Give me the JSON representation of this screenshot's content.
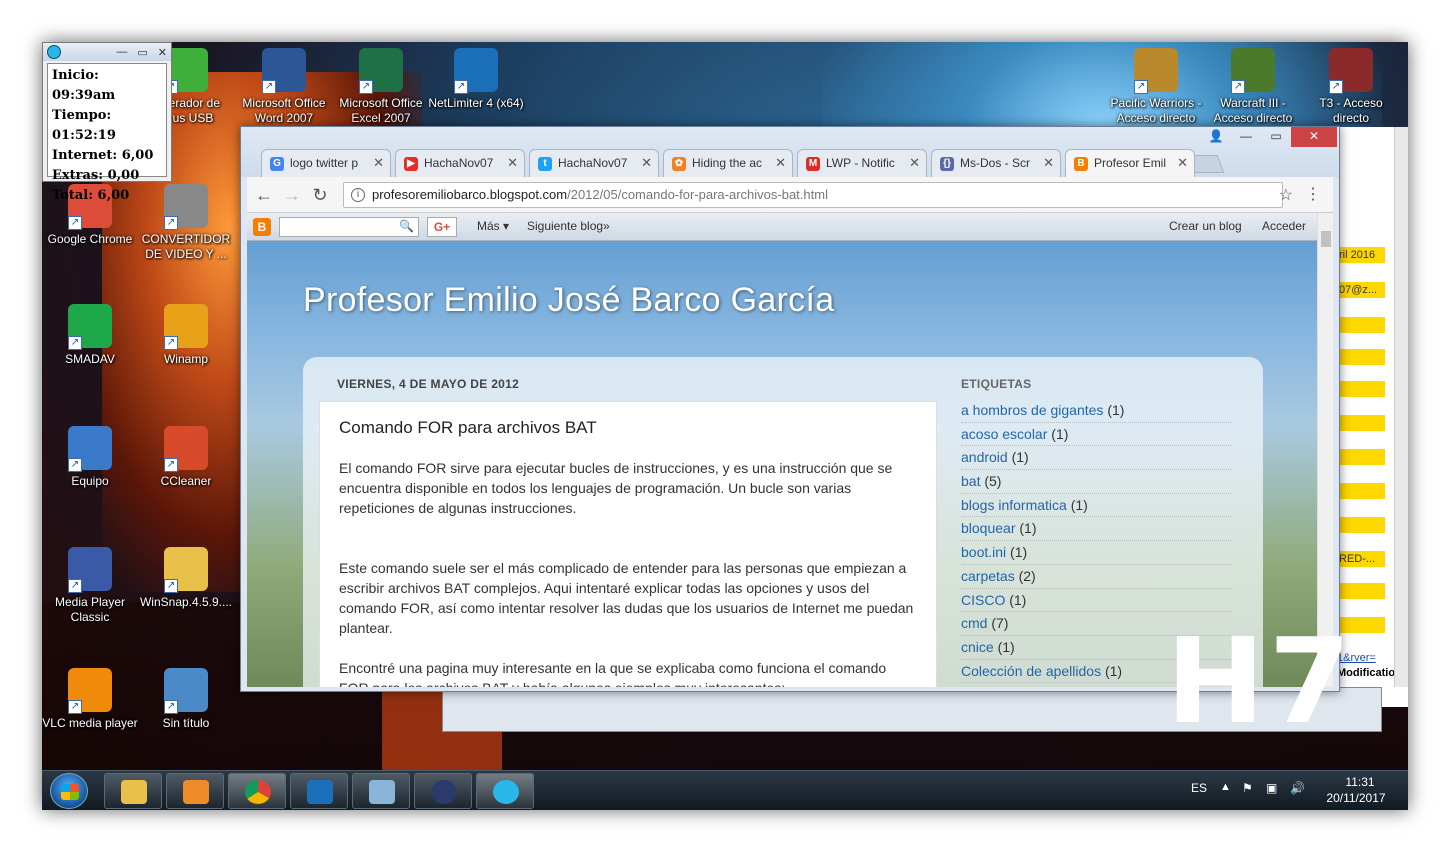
{
  "timer": {
    "lines": [
      "Inicio: 09:39am",
      "Tiempo: 01:52:19",
      "Internet:  6,00",
      "Extras:  0,00",
      "Total:  6,00"
    ]
  },
  "desktop_icons": [
    {
      "label": "...perador de ...rus USB",
      "name": "usb-recovery-icon",
      "color": "#3fae3a"
    },
    {
      "label": "Microsoft Office Word 2007",
      "name": "word-icon",
      "color": "#2b5797"
    },
    {
      "label": "Microsoft Office Excel 2007",
      "name": "excel-icon",
      "color": "#1e7145"
    },
    {
      "label": "NetLimiter 4 (x64)",
      "name": "netlimiter-icon",
      "color": "#1b6fb8"
    },
    {
      "label": "Pacific Warriors - Acceso directo",
      "name": "pacific-warriors-icon",
      "color": "#b88a2c"
    },
    {
      "label": "Warcraft III - Acceso directo",
      "name": "warcraft-icon",
      "color": "#4a7a2a"
    },
    {
      "label": "T3 - Acceso directo",
      "name": "t3-icon",
      "color": "#8a2a2a"
    },
    {
      "label": "Google Chrome",
      "name": "chrome-icon",
      "color": "#dd4b39"
    },
    {
      "label": "CONVERTIDOR DE VIDEO Y ...",
      "name": "video-converter-icon",
      "color": "#888888"
    },
    {
      "label": "SMADAV",
      "name": "smadav-icon",
      "color": "#1fa84a"
    },
    {
      "label": "Winamp",
      "name": "winamp-icon",
      "color": "#e8a21a"
    },
    {
      "label": "Equipo",
      "name": "computer-icon",
      "color": "#3a7ac8"
    },
    {
      "label": "CCleaner",
      "name": "ccleaner-icon",
      "color": "#d84a2a"
    },
    {
      "label": "Media Player Classic",
      "name": "media-player-classic-icon",
      "color": "#3a5aa8"
    },
    {
      "label": "WinSnap.4.5.9....",
      "name": "winsnap-folder-icon",
      "color": "#e8c04a"
    },
    {
      "label": "VLC media player",
      "name": "vlc-icon",
      "color": "#f08a0a"
    },
    {
      "label": "Sin título",
      "name": "untitled-file-icon",
      "color": "#4a8ac8"
    }
  ],
  "browser": {
    "tabs": [
      {
        "label": "logo twitter p",
        "name": "tab-logo-twitter",
        "icon": "G",
        "color": "#4285f4"
      },
      {
        "label": "HachaNov07",
        "name": "tab-youtube-hachanov07",
        "icon": "▶",
        "color": "#e52d27"
      },
      {
        "label": "HachaNov07",
        "name": "tab-twitter-hachanov07",
        "icon": "t",
        "color": "#1da1f2"
      },
      {
        "label": "Hiding the ac",
        "name": "tab-hiding",
        "icon": "✿",
        "color": "#f48024"
      },
      {
        "label": "LWP - Notific",
        "name": "tab-gmail-lwp",
        "icon": "M",
        "color": "#d93025"
      },
      {
        "label": "Ms-Dos - Scr",
        "name": "tab-msdos",
        "icon": "{}",
        "color": "#5a6aa8"
      },
      {
        "label": "Profesor Emil",
        "name": "tab-profesor-emilio",
        "icon": "B",
        "color": "#f57d00"
      }
    ],
    "url_host": "profesoremiliobarco.blogspot.com",
    "url_path": "/2012/05/comando-for-para-archivos-bat.html",
    "navbar": {
      "more": "Más ▾",
      "next_blog": "Siguiente blog»",
      "create_blog": "Crear un blog",
      "sign_in": "Acceder"
    },
    "blog_title": "Profesor Emilio José Barco García",
    "post_date": "VIERNES, 4 DE MAYO DE 2012",
    "post_title": "Comando FOR para archivos BAT",
    "paragraphs": [
      "El comando FOR sirve para ejecutar bucles de instrucciones, y es una instrucción que se encuentra disponible en todos los lenguajes de programación. Un bucle son varias repeticiones de algunas instrucciones.",
      "Este comando suele ser el más complicado de entender para las personas que empiezan a escribir archivos BAT complejos. Aqui intentaré explicar todas las opciones y usos del comando FOR, así como intentar resolver las dudas que los usuarios de Internet me puedan plantear.",
      "Encontré una pagina muy interesante en la que se explicaba como funciona el comando FOR para los archivos BAT y había algunos ejemplos muy interesantes:"
    ],
    "labels_title": "ETIQUETAS",
    "labels": [
      {
        "name": "a hombros de gigantes",
        "count": "(1)"
      },
      {
        "name": "acoso escolar",
        "count": "(1)"
      },
      {
        "name": "android",
        "count": "(1)"
      },
      {
        "name": "bat",
        "count": "(5)"
      },
      {
        "name": "blogs informatica",
        "count": "(1)"
      },
      {
        "name": "bloquear",
        "count": "(1)"
      },
      {
        "name": "boot.ini",
        "count": "(1)"
      },
      {
        "name": "carpetas",
        "count": "(2)"
      },
      {
        "name": "CISCO",
        "count": "(1)"
      },
      {
        "name": "cmd",
        "count": "(7)"
      },
      {
        "name": "cnice",
        "count": "(1)"
      },
      {
        "name": "Colección de apellidos",
        "count": "(1)"
      }
    ]
  },
  "bgwindow": {
    "cells": [
      "ril 2016",
      "07@z...",
      "RED-..."
    ],
    "link": "1&rver=",
    "col": "Modification"
  },
  "watermark": "H7",
  "tray": {
    "lang": "ES",
    "time": "11:31",
    "date": "20/11/2017"
  }
}
